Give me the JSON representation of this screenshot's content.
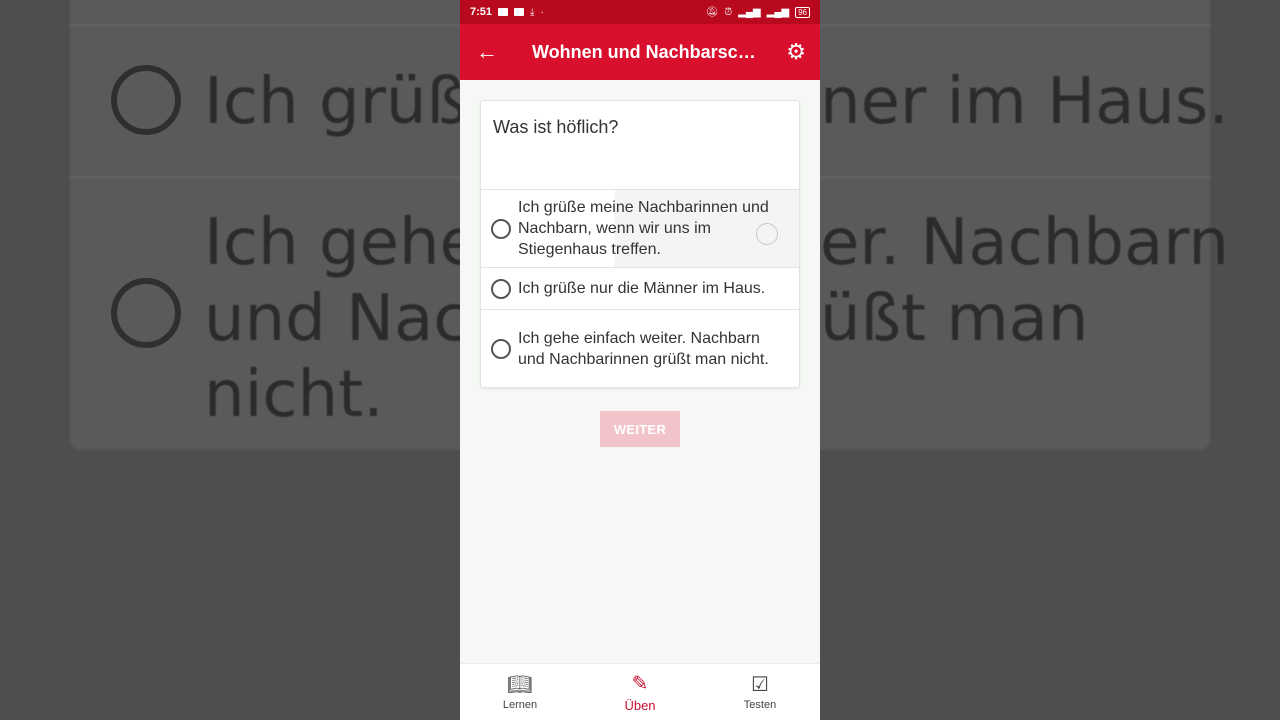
{
  "status_bar": {
    "time": "7:51",
    "battery": "96"
  },
  "app_bar": {
    "title": "Wohnen und Nachbarsc…",
    "back_icon": "arrow-left-icon",
    "settings_icon": "gear-icon"
  },
  "quiz": {
    "question": "Was ist höflich?",
    "options": [
      {
        "label": "Ich grüße meine Nachbarinnen und Nachbarn, wenn wir uns im Stiegenhaus treffen."
      },
      {
        "label": "Ich grüße nur die Männer im Haus."
      },
      {
        "label": "Ich gehe einfach weiter. Nachbarn und Nachbarinnen grüßt man nicht."
      }
    ],
    "next_button": "WEITER"
  },
  "bottom_nav": {
    "items": [
      {
        "label": "Lernen",
        "icon": "book-icon"
      },
      {
        "label": "Üben",
        "icon": "edit-icon"
      },
      {
        "label": "Testen",
        "icon": "checkbox-icon"
      }
    ],
    "active": "Üben"
  },
  "background_text": {
    "line1_left": "Ich grüße",
    "line1_right": "ner im Haus.",
    "line2_left": "Ich gehe",
    "line2_right": "er. Nachbarn",
    "line3_left": "und Nach",
    "line3_right": "üßt man",
    "line4_left": "nicht."
  },
  "colors": {
    "primary": "#d8102e",
    "status_bar": "#b8091f",
    "button_disabled": "#f2c4ca"
  }
}
